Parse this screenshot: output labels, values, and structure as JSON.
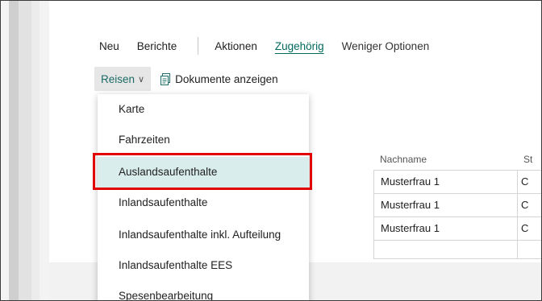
{
  "actionbar": {
    "items": [
      "Neu",
      "Berichte",
      "Aktionen",
      "Zugehörig",
      "Weniger Optionen"
    ]
  },
  "subbar": {
    "reisen_label": "Reisen",
    "documents_label": "Dokumente anzeigen"
  },
  "table": {
    "header_nachname": "Nachname",
    "header_st": "St",
    "rows": [
      {
        "nachname": "Musterfrau 1",
        "st": "C"
      },
      {
        "nachname": "Musterfrau 1",
        "st": "C"
      },
      {
        "nachname": "Musterfrau 1",
        "st": "C"
      },
      {
        "nachname": "",
        "st": ""
      }
    ]
  },
  "menu": {
    "items": [
      "Karte",
      "Fahrzeiten",
      "Auslandsaufenthalte",
      "Inlandsaufenthalte",
      "Inlandsaufenthalte inkl. Aufteilung",
      "Inlandsaufenthalte EES",
      "Spesenbearbeitung"
    ],
    "selected": "Auslandsaufenthalte"
  },
  "colors": {
    "accent": "#00695c",
    "highlight": "#e00000",
    "selected_bg": "#d9eeec"
  }
}
